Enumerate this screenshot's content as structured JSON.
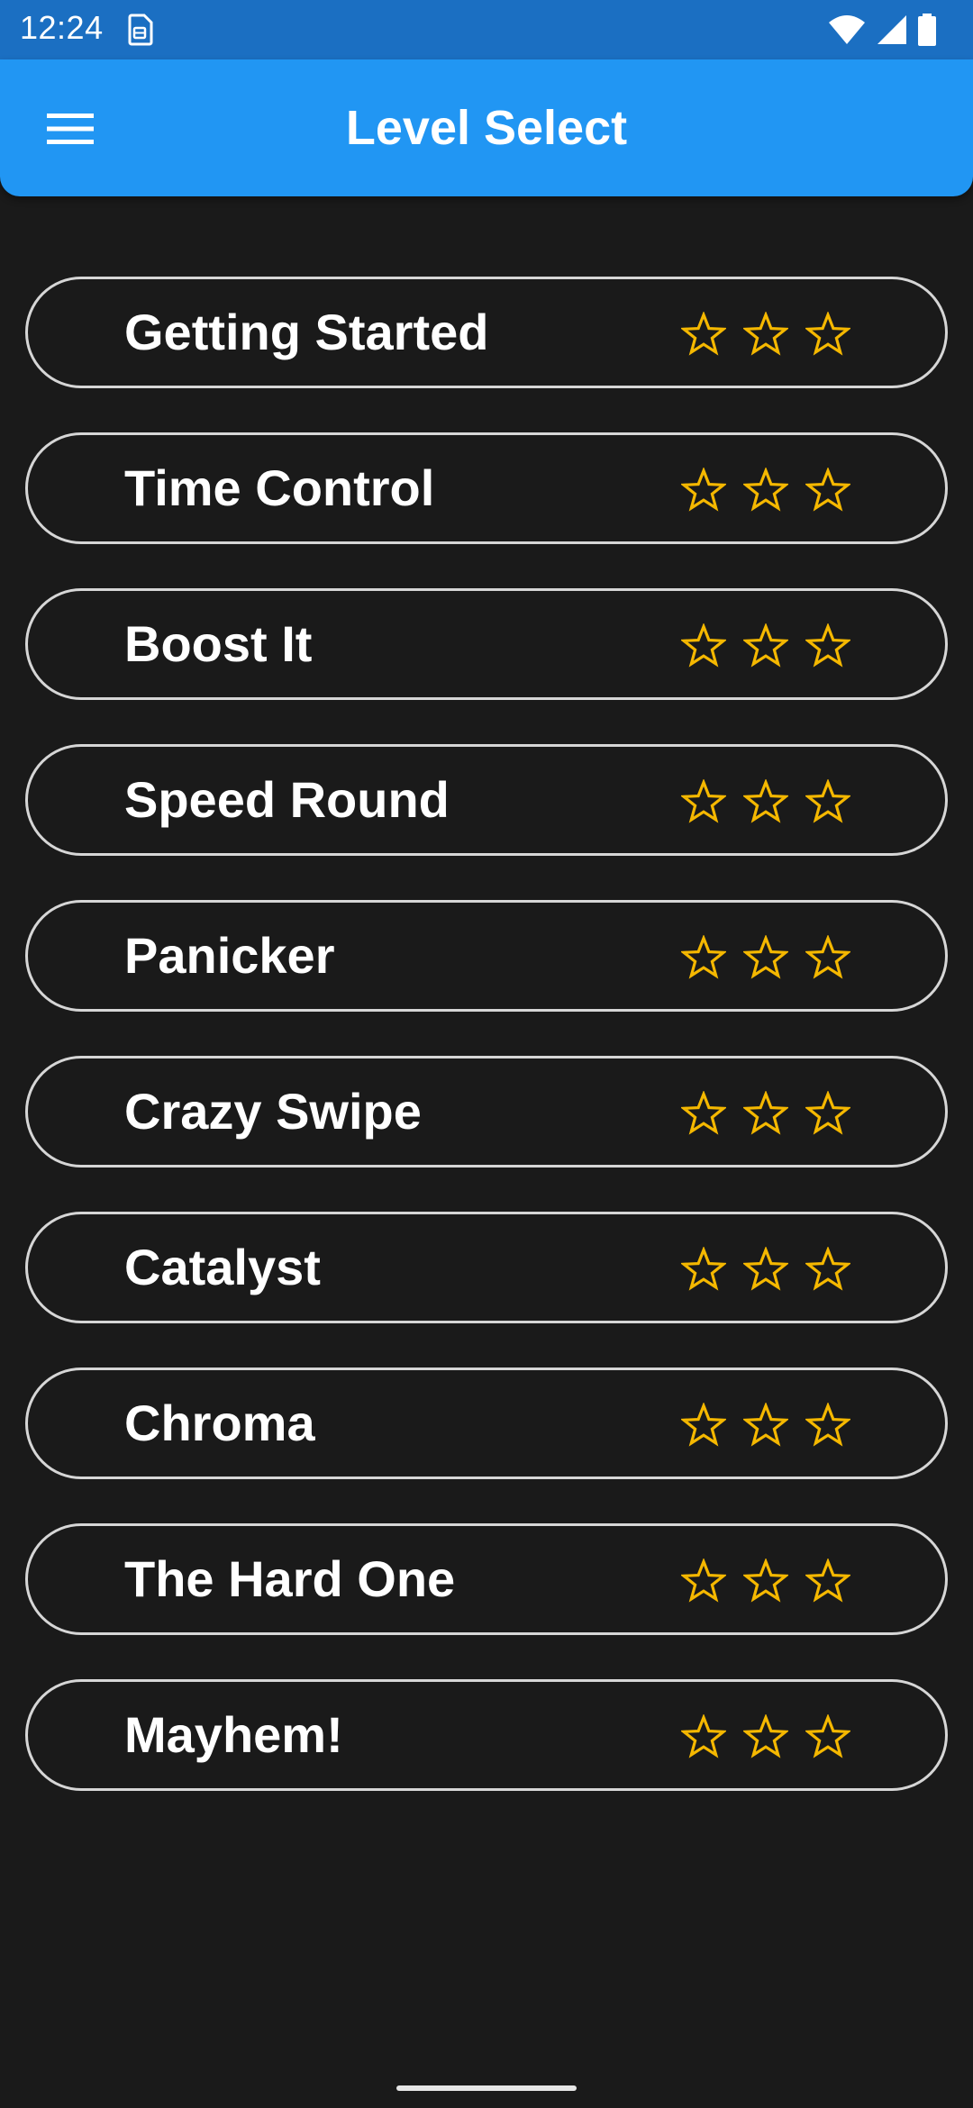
{
  "status_bar": {
    "time": "12:24",
    "icons": [
      "sim-card-icon",
      "wifi-icon",
      "signal-icon",
      "battery-icon"
    ]
  },
  "app_bar": {
    "title": "Level Select",
    "menu_icon": "hamburger-menu-icon",
    "color": "#2196f3"
  },
  "levels": [
    {
      "name": "Getting Started",
      "stars_earned": 0,
      "stars_total": 3
    },
    {
      "name": "Time Control",
      "stars_earned": 0,
      "stars_total": 3
    },
    {
      "name": "Boost It",
      "stars_earned": 0,
      "stars_total": 3
    },
    {
      "name": "Speed Round",
      "stars_earned": 0,
      "stars_total": 3
    },
    {
      "name": "Panicker",
      "stars_earned": 0,
      "stars_total": 3
    },
    {
      "name": "Crazy Swipe",
      "stars_earned": 0,
      "stars_total": 3
    },
    {
      "name": "Catalyst",
      "stars_earned": 0,
      "stars_total": 3
    },
    {
      "name": "Chroma",
      "stars_earned": 0,
      "stars_total": 3
    },
    {
      "name": "The Hard One",
      "stars_earned": 0,
      "stars_total": 3
    },
    {
      "name": "Mayhem!",
      "stars_earned": 0,
      "stars_total": 3
    }
  ],
  "colors": {
    "background": "#1a1a1a",
    "star": "#f5b800",
    "item_border": "#d6d6d6",
    "status_bar": "#1b6fc2"
  }
}
